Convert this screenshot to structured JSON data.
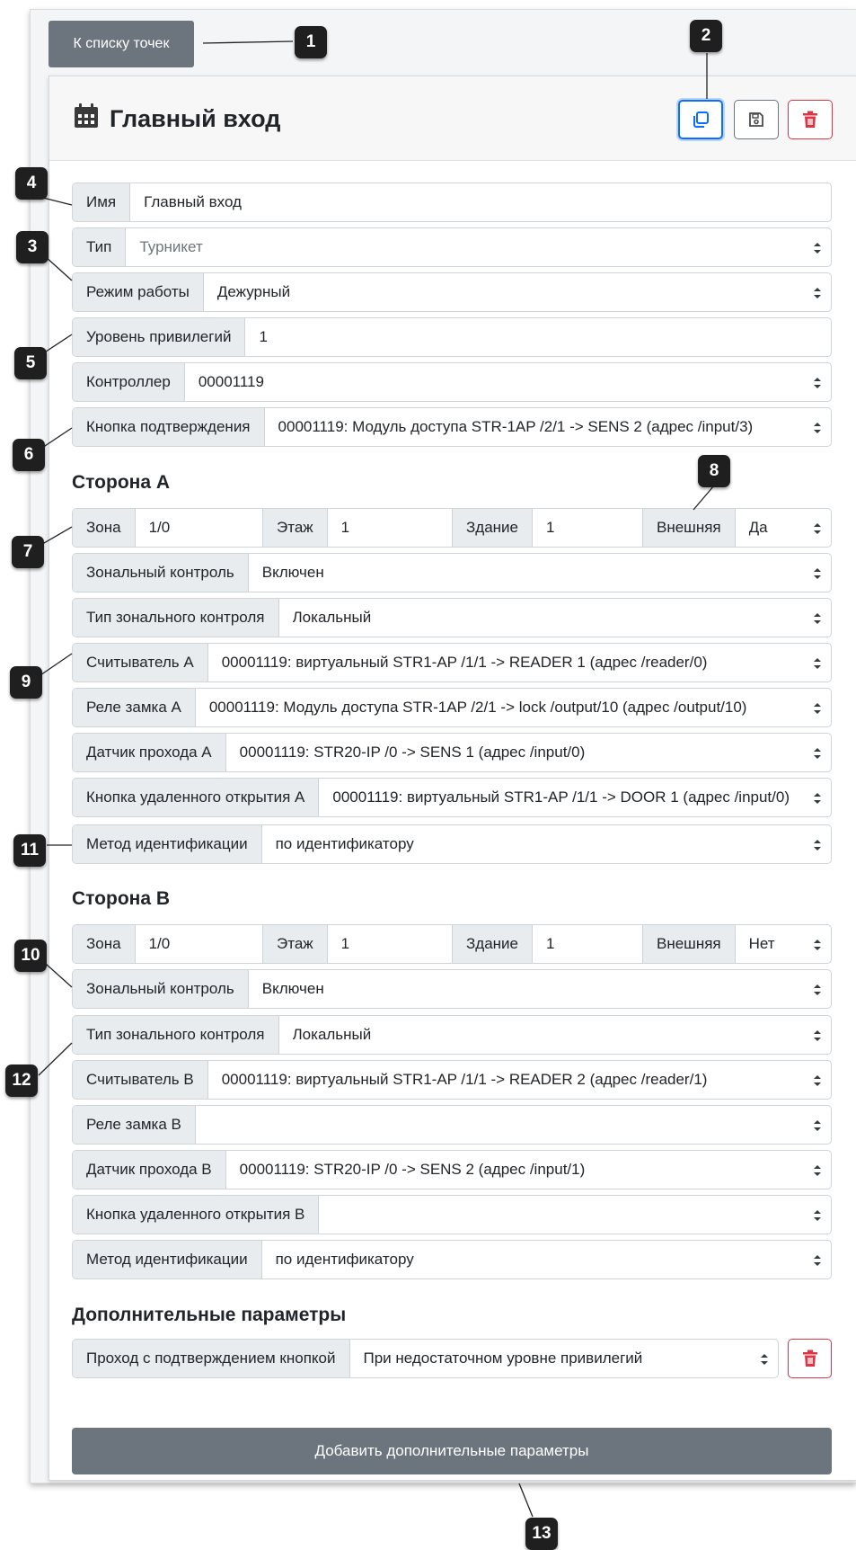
{
  "back_button": "К списку точек",
  "title": "Главный вход",
  "icons": {
    "title": "calendar-icon",
    "copy": "copy-icon",
    "save": "save-icon",
    "delete": "trash-icon",
    "select": "select-caret-icon"
  },
  "colors": {
    "primary": "#0d6efd",
    "secondary": "#6c757d",
    "danger": "#dc3545",
    "label_bg": "#e9ecef"
  },
  "general": {
    "name": {
      "label": "Имя",
      "value": "Главный вход"
    },
    "type": {
      "label": "Тип",
      "value": "Турникет"
    },
    "mode": {
      "label": "Режим работы",
      "value": "Дежурный"
    },
    "privilege": {
      "label": "Уровень привилегий",
      "value": "1"
    },
    "controller": {
      "label": "Контроллер",
      "value": "00001119"
    },
    "confirm_button": {
      "label": "Кнопка подтверждения",
      "value": "00001119: Модуль доступа STR-1AP /2/1 -> SENS 2 (адрес /input/3)"
    }
  },
  "side_a": {
    "heading": "Сторона А",
    "zone": {
      "label": "Зона",
      "value": "1/0"
    },
    "floor": {
      "label": "Этаж",
      "value": "1"
    },
    "building": {
      "label": "Здание",
      "value": "1"
    },
    "external": {
      "label": "Внешняя",
      "value": "Да"
    },
    "zonal_control": {
      "label": "Зональный контроль",
      "value": "Включен"
    },
    "zonal_type": {
      "label": "Тип зонального контроля",
      "value": "Локальный"
    },
    "reader": {
      "label": "Считыватель А",
      "value": "00001119: виртуальный STR1-AP /1/1 -> READER 1 (адрес /reader/0)"
    },
    "lock_relay": {
      "label": "Реле замка А",
      "value": "00001119: Модуль доступа STR-1AP /2/1 -> lock /output/10 (адрес /output/10)"
    },
    "pass_sensor": {
      "label": "Датчик прохода А",
      "value": "00001119: STR20-IP /0 -> SENS 1 (адрес /input/0)"
    },
    "remote_button": {
      "label": "Кнопка удаленного открытия А",
      "value": "00001119: виртуальный STR1-AP /1/1 -> DOOR 1 (адрес /input/0)"
    },
    "id_method": {
      "label": "Метод идентификации",
      "value": "по идентификатору"
    }
  },
  "side_b": {
    "heading": "Сторона В",
    "zone": {
      "label": "Зона",
      "value": "1/0"
    },
    "floor": {
      "label": "Этаж",
      "value": "1"
    },
    "building": {
      "label": "Здание",
      "value": "1"
    },
    "external": {
      "label": "Внешняя",
      "value": "Нет"
    },
    "zonal_control": {
      "label": "Зональный контроль",
      "value": "Включен"
    },
    "zonal_type": {
      "label": "Тип зонального контроля",
      "value": "Локальный"
    },
    "reader": {
      "label": "Считыватель В",
      "value": "00001119: виртуальный STR1-AP /1/1 -> READER 2 (адрес /reader/1)"
    },
    "lock_relay": {
      "label": "Реле замка В",
      "value": ""
    },
    "pass_sensor": {
      "label": "Датчик прохода В",
      "value": "00001119: STR20-IP /0 -> SENS 2 (адрес /input/1)"
    },
    "remote_button": {
      "label": "Кнопка удаленного открытия В",
      "value": ""
    },
    "id_method": {
      "label": "Метод идентификации",
      "value": "по идентификатору"
    }
  },
  "extra": {
    "heading": "Дополнительные параметры",
    "confirm_pass": {
      "label": "Проход с подтверждением кнопкой",
      "value": "При недостаточном уровне привилегий"
    },
    "add_button": "Добавить дополнительные параметры"
  },
  "markers": [
    "1",
    "2",
    "3",
    "4",
    "5",
    "6",
    "7",
    "8",
    "9",
    "10",
    "11",
    "12",
    "13"
  ]
}
